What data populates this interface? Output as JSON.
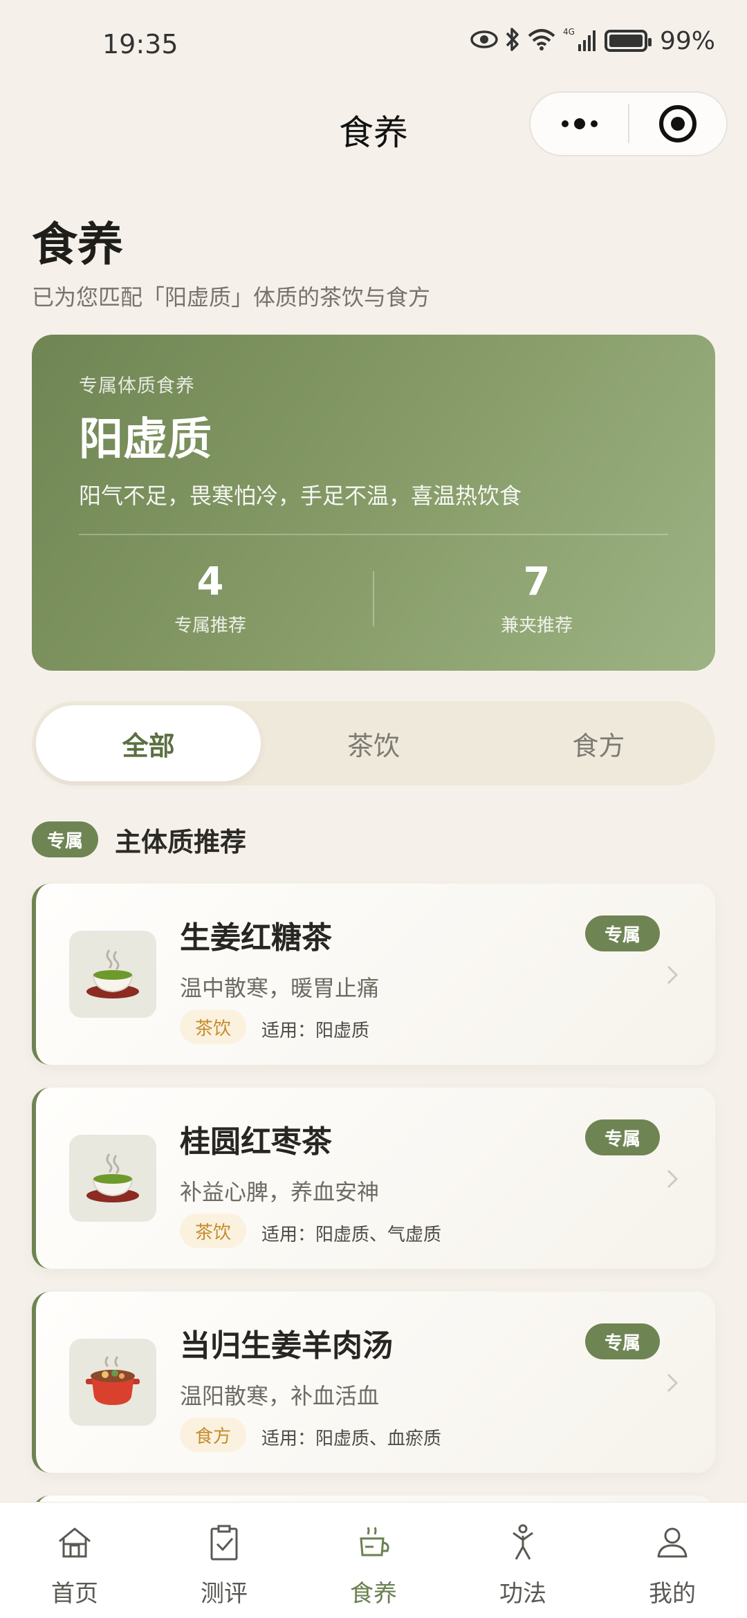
{
  "status_bar": {
    "time": "19:35",
    "battery_pct": "99%",
    "network": "4G",
    "icons": [
      "eye-icon",
      "bluetooth-icon",
      "wifi-icon",
      "signal-icon",
      "battery-icon"
    ]
  },
  "nav": {
    "title": "食养",
    "icons": [
      "more-dots-icon",
      "target-circle-icon"
    ]
  },
  "header": {
    "title": "食养",
    "subtitle": "已为您匹配「阳虚质」体质的茶饮与食方"
  },
  "hero": {
    "kicker": "专属体质食养",
    "constitution": "阳虚质",
    "description": "阳气不足，畏寒怕冷，手足不温，喜温热饮食",
    "stats": [
      {
        "value": "4",
        "label": "专属推荐"
      },
      {
        "value": "7",
        "label": "兼夹推荐"
      }
    ],
    "gradient_colors": [
      "#6f8553",
      "#9db384"
    ]
  },
  "tabs": [
    {
      "label": "全部",
      "active": true
    },
    {
      "label": "茶饮",
      "active": false
    },
    {
      "label": "食方",
      "active": false
    }
  ],
  "section": {
    "pill": "专属",
    "title": "主体质推荐"
  },
  "cards": [
    {
      "name": "生姜红糖茶",
      "desc": "温中散寒，暖胃止痛",
      "tag": "茶饮",
      "fit": "适用：阳虚质",
      "badge": "专属",
      "icon": "tea-cup-icon"
    },
    {
      "name": "桂圆红枣茶",
      "desc": "补益心脾，养血安神",
      "tag": "茶饮",
      "fit": "适用：阳虚质、气虚质",
      "badge": "专属",
      "icon": "tea-cup-icon"
    },
    {
      "name": "当归生姜羊肉汤",
      "desc": "温阳散寒，补血活血",
      "tag": "食方",
      "fit": "适用：阳虚质、血瘀质",
      "badge": "专属",
      "icon": "stew-pot-icon"
    }
  ],
  "bottom_nav": [
    {
      "label": "首页",
      "icon": "home-icon",
      "active": false
    },
    {
      "label": "测评",
      "icon": "clipboard-check-icon",
      "active": false
    },
    {
      "label": "食养",
      "icon": "food-bowl-icon",
      "active": true
    },
    {
      "label": "功法",
      "icon": "exercise-figure-icon",
      "active": false
    },
    {
      "label": "我的",
      "icon": "user-icon",
      "active": false
    }
  ],
  "colors": {
    "accent": "#6f8453",
    "background": "#f5f1ea",
    "tag_bg": "#fbf1df",
    "tag_text": "#c28d2b"
  }
}
